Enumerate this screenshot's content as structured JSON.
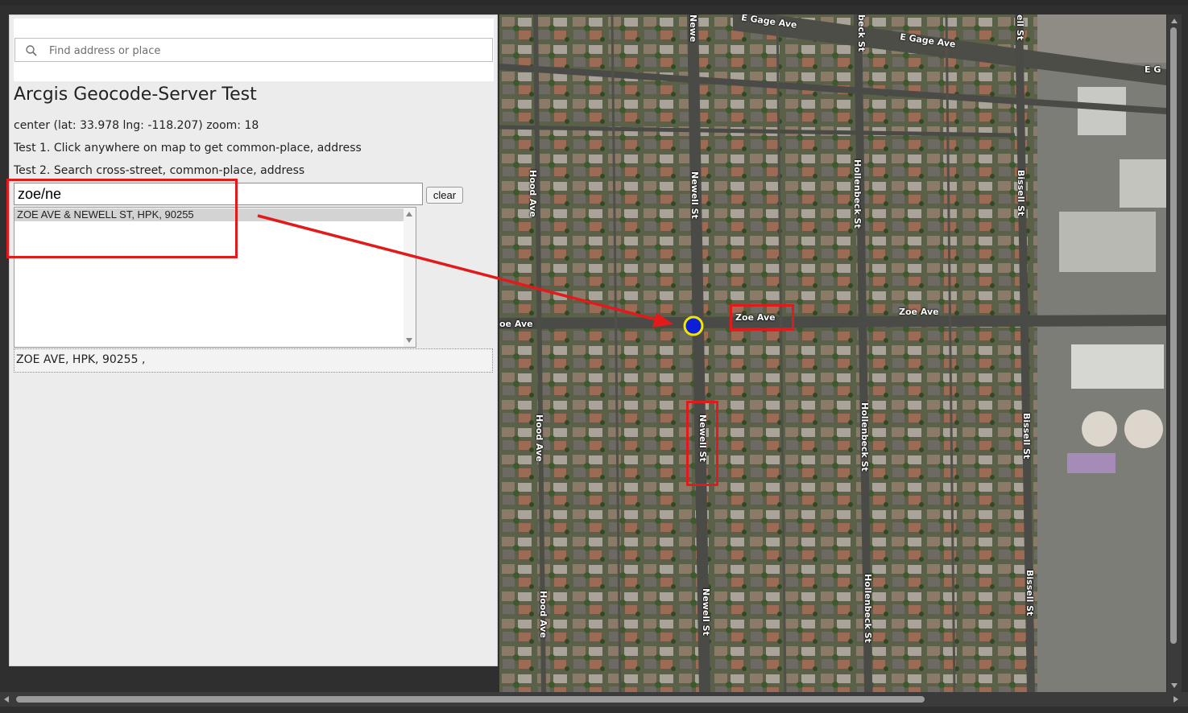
{
  "search": {
    "placeholder": "Find address or place"
  },
  "page": {
    "title": "Arcgis Geocode-Server Test",
    "center_text": "center (lat: 33.978 lng: -118.207) zoom: 18",
    "test1_text": "Test 1. Click anywhere on map to get common-place, address",
    "test2_text": "Test 2. Search cross-street, common-place, address"
  },
  "query": {
    "value": "zoe/ne",
    "clear_label": "clear"
  },
  "suggestions": {
    "items": [
      "ZOE AVE & NEWELL ST, HPK, 90255"
    ]
  },
  "result": {
    "text": "ZOE AVE, HPK, 90255 ,"
  },
  "map": {
    "labels": {
      "e_gage_ave_1": "E Gage Ave",
      "e_gage_ave_2": "E Gage Ave",
      "e_gage_ave_3": "E G",
      "zoe_ave_left": "oe Ave",
      "zoe_ave_mid": "Zoe Ave",
      "zoe_ave_right": "Zoe Ave",
      "newell_top": "Newe",
      "newell_1": "Newell St",
      "newell_2": "Newell St",
      "newell_3": "Newell St",
      "hood_1": "Hood Ave",
      "hood_2": "Hood Ave",
      "hood_3": "Hood Ave",
      "hollenbeck_top": "beck St",
      "hollenbeck_1": "Hollenbeck St",
      "hollenbeck_2": "Hollenbeck St",
      "hollenbeck_3": "Hollenbeck St",
      "bissell_top": "ell St",
      "bissell_1": "Bissell St",
      "bissell_2": "Bissell St",
      "bissell_3": "Bissell St"
    },
    "marker": {
      "fill": "#0a1fd6",
      "ring": "#f2e600"
    }
  },
  "colors": {
    "annotation": "#e11b1b",
    "panel_bg": "#ececec"
  }
}
